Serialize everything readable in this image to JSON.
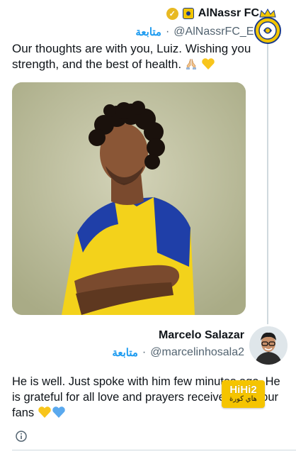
{
  "tweet1": {
    "display_name": "AlNassr FC",
    "handle": "@AlNassrFC_EN",
    "follow_label": "متابعة",
    "separator": "·",
    "text": "Our thoughts are with you, Luiz. Wishing you strength, and the best of health.",
    "emojis": [
      "folded-hands",
      "yellow-heart"
    ]
  },
  "tweet2": {
    "display_name": "Marcelo Salazar",
    "handle": "@marcelinhosala2",
    "follow_label": "متابعة",
    "separator": "·",
    "text": "He is well. Just spoke with him few minutes ago. He is grateful for all love and prayers  received from our fans",
    "emojis": [
      "yellow-heart",
      "blue-heart"
    ]
  },
  "watermark": {
    "line1": "HiHi2",
    "line2": "هاي كورة"
  },
  "colors": {
    "link_blue": "#1d9bf0",
    "muted": "#536471",
    "club_yellow": "#f2c500",
    "club_blue": "#1a3a8a",
    "watermark_yellow": "#f5c400"
  },
  "icons": [
    "verified-badge-icon",
    "club-mini-logo-icon",
    "info-icon"
  ]
}
